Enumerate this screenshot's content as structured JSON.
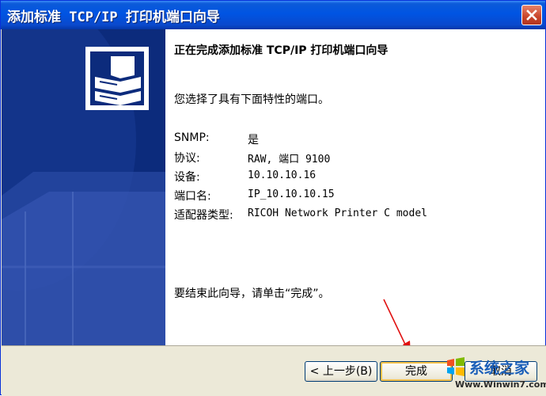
{
  "window": {
    "title": "添加标准 TCP/IP 打印机端口向导"
  },
  "content": {
    "heading": "正在完成添加标准 TCP/IP 打印机端口向导",
    "intro": "您选择了具有下面特性的端口。",
    "properties": [
      {
        "label": "SNMP:",
        "value": "是"
      },
      {
        "label": "协议:",
        "value": "RAW, 端口 9100"
      },
      {
        "label": "设备:",
        "value": "10.10.10.16"
      },
      {
        "label": "端口名:",
        "value": "IP_10.10.10.15"
      },
      {
        "label": "适配器类型:",
        "value": "RICOH Network Printer C model"
      }
    ],
    "finish_note": "要结束此向导，请单击“完成”。"
  },
  "buttons": {
    "back": "< 上一步(B)",
    "finish": "完成",
    "cancel": "取消"
  },
  "watermark": {
    "brand": "系统之家",
    "url": "Www.Winwin7.com"
  }
}
